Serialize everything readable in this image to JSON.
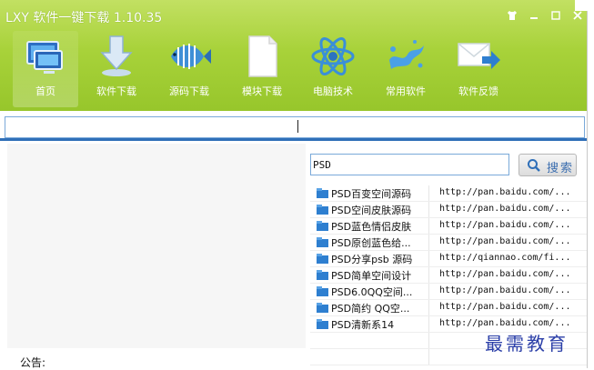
{
  "window": {
    "title": "LXY 软件一键下载 1.10.35",
    "controls": [
      "skin",
      "minimize",
      "maximize",
      "close"
    ]
  },
  "nav": [
    {
      "label": "首页",
      "icon": "monitor-icon"
    },
    {
      "label": "软件下载",
      "icon": "download-arrow-icon"
    },
    {
      "label": "源码下载",
      "icon": "fish-icon"
    },
    {
      "label": "模块下载",
      "icon": "document-icon"
    },
    {
      "label": "电脑技术",
      "icon": "atom-icon"
    },
    {
      "label": "常用软件",
      "icon": "splash-icon"
    },
    {
      "label": "软件反馈",
      "icon": "mail-arrow-icon"
    }
  ],
  "search": {
    "value": "PSD",
    "button_label": "搜索"
  },
  "results": [
    {
      "name": "PSD百变空间源码",
      "url": "http://pan.baidu.com/..."
    },
    {
      "name": "PSD空间皮肤源码",
      "url": "http://pan.baidu.com/..."
    },
    {
      "name": "PSD蓝色情侣皮肤",
      "url": "http://pan.baidu.com/..."
    },
    {
      "name": "PSD原创蓝色给...",
      "url": "http://pan.baidu.com/..."
    },
    {
      "name": "PSD分享psb 源码",
      "url": "http://qiannao.com/fi..."
    },
    {
      "name": "PSD简单空间设计",
      "url": "http://pan.baidu.com/..."
    },
    {
      "name": "PSD6.0QQ空间...",
      "url": "http://pan.baidu.com/..."
    },
    {
      "name": "PSD简约 QQ空...",
      "url": "http://pan.baidu.com/..."
    },
    {
      "name": "PSD清新系14",
      "url": "http://pan.baidu.com/..."
    }
  ],
  "notice_label": "公告:",
  "watermark": "最需教育",
  "colors": {
    "titlebar_green": "#a8d23a",
    "accent_blue": "#2f6fb8",
    "watermark_blue": "#2b3fa8"
  }
}
